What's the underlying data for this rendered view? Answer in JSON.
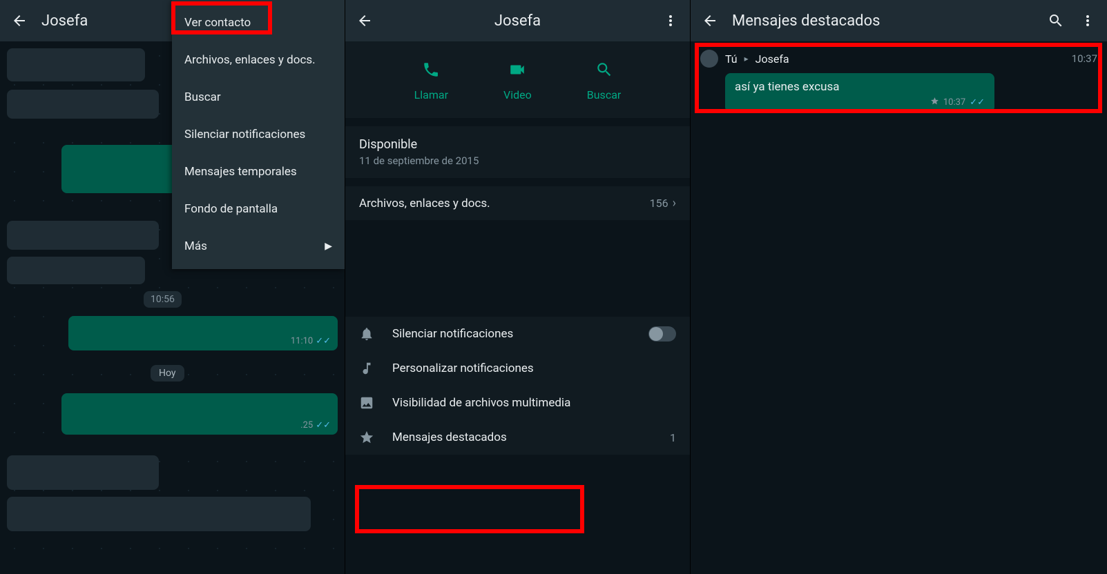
{
  "panel1": {
    "title": "Josefa",
    "menu": {
      "items": [
        "Ver contacto",
        "Archivos, enlaces y docs.",
        "Buscar",
        "Silenciar notificaciones",
        "Mensajes temporales",
        "Fondo de pantalla",
        "Más"
      ]
    },
    "chips": {
      "ts1": "10:56",
      "day": "Hoy"
    },
    "bubble_out1_time": "11:10",
    "bubble_out2_time": ".25"
  },
  "panel2": {
    "title": "Josefa",
    "actions": {
      "call": "Llamar",
      "video": "Video",
      "search": "Buscar"
    },
    "status_title": "Disponible",
    "status_date": "11 de septiembre de 2015",
    "media_label": "Archivos, enlaces y docs.",
    "media_count": "156",
    "settings": {
      "mute": "Silenciar notificaciones",
      "custom": "Personalizar notificaciones",
      "visibility": "Visibilidad de archivos multimedia",
      "starred": "Mensajes destacados",
      "starred_count": "1"
    }
  },
  "panel3": {
    "title": "Mensajes destacados",
    "message": {
      "from": "Tú",
      "to": "Josefa",
      "header_time": "10:37",
      "text": "así ya tienes excusa",
      "bubble_time": "10:37"
    }
  }
}
